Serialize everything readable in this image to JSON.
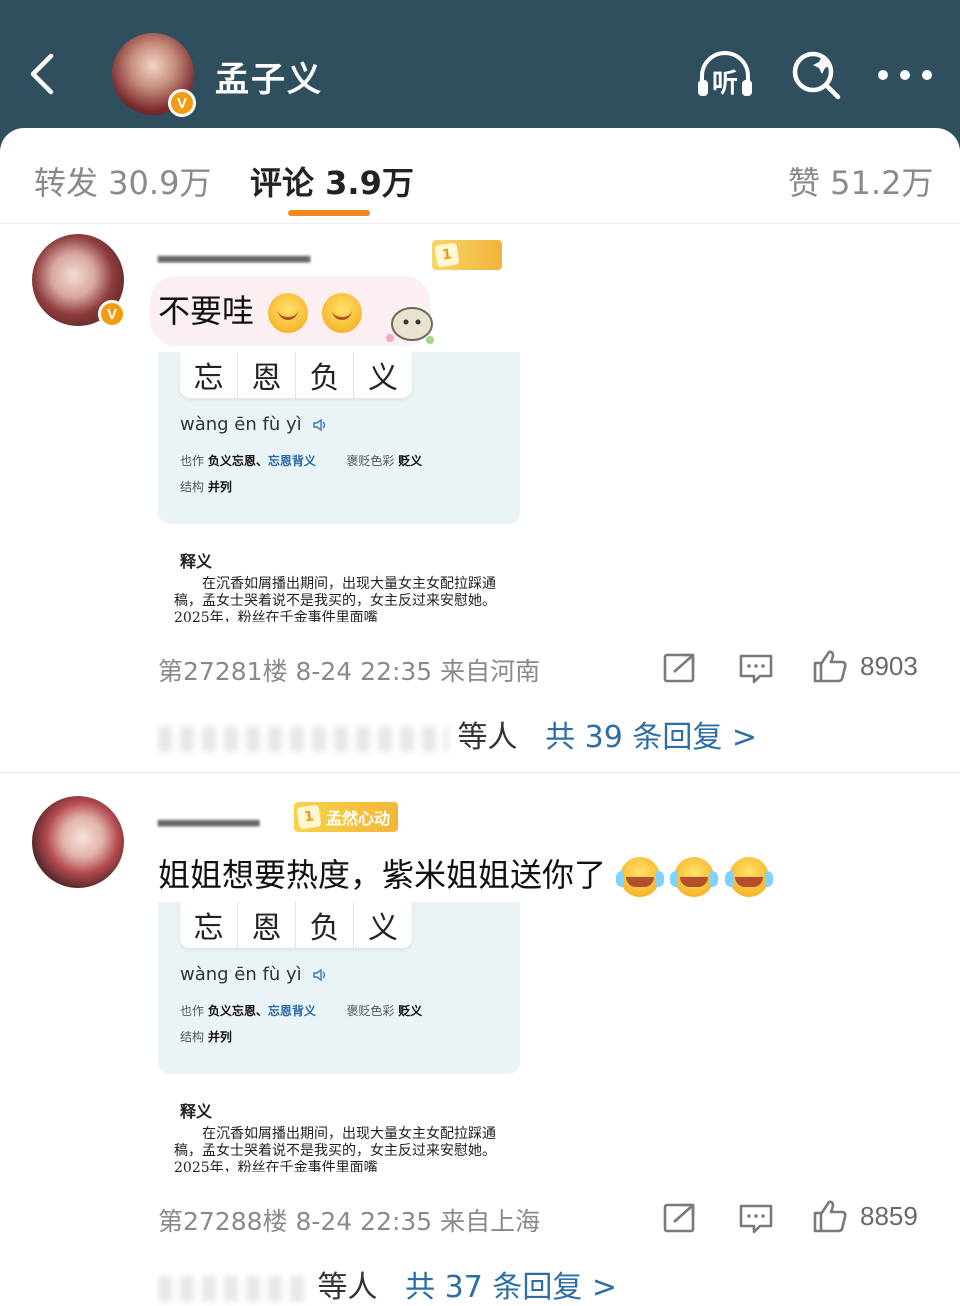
{
  "header": {
    "title": "孟子义",
    "listen_label": "听",
    "verified_label": "V"
  },
  "tabs": [
    {
      "label": "转发 30.9万"
    },
    {
      "label": "评论 3.9万"
    },
    {
      "label": "赞 51.2万"
    }
  ],
  "active_tab": "评论 3.9万",
  "colors": {
    "header_bg": "#2f4f5f",
    "tab_indicator": "#f08a1c",
    "reply_link": "#2e6ea6",
    "verified_badge": "#f39c12"
  },
  "dictionary_card": {
    "chars": [
      "忘",
      "恩",
      "负",
      "义"
    ],
    "pinyin": "wàng ēn fù yì",
    "also_label": "也作",
    "also_value_1": "负义忘恩、",
    "also_value_2": "忘恩背义",
    "tone_label": "褒贬色彩",
    "tone_value": "贬义",
    "structure_label": "结构",
    "structure_value": "并列",
    "section_title": "释义",
    "body": "在沉香如屑播出期间，出现大量女主女配拉踩通稿，孟女士哭着说不是我买的，女主反过来安慰她。2025年，粉丝在千金事件里面嘴"
  },
  "comments": [
    {
      "text": "不要哇",
      "floor_info": "第27281楼 8-24 22:35 来自河南",
      "likes": "8903",
      "reply_who": "等人",
      "reply_link": "共 39 条回复 >",
      "badge_level": "1",
      "badge_label": "",
      "emojis": [
        "shy",
        "shy"
      ]
    },
    {
      "text": "姐姐想要热度，紫米姐姐送你了",
      "floor_info": "第27288楼 8-24 22:35 来自上海",
      "likes": "8859",
      "reply_who": "等人",
      "reply_link": "共 37 条回复 >",
      "badge_level": "1",
      "badge_label": "孟然心动",
      "emojis": [
        "cry",
        "cry",
        "cry"
      ]
    }
  ]
}
